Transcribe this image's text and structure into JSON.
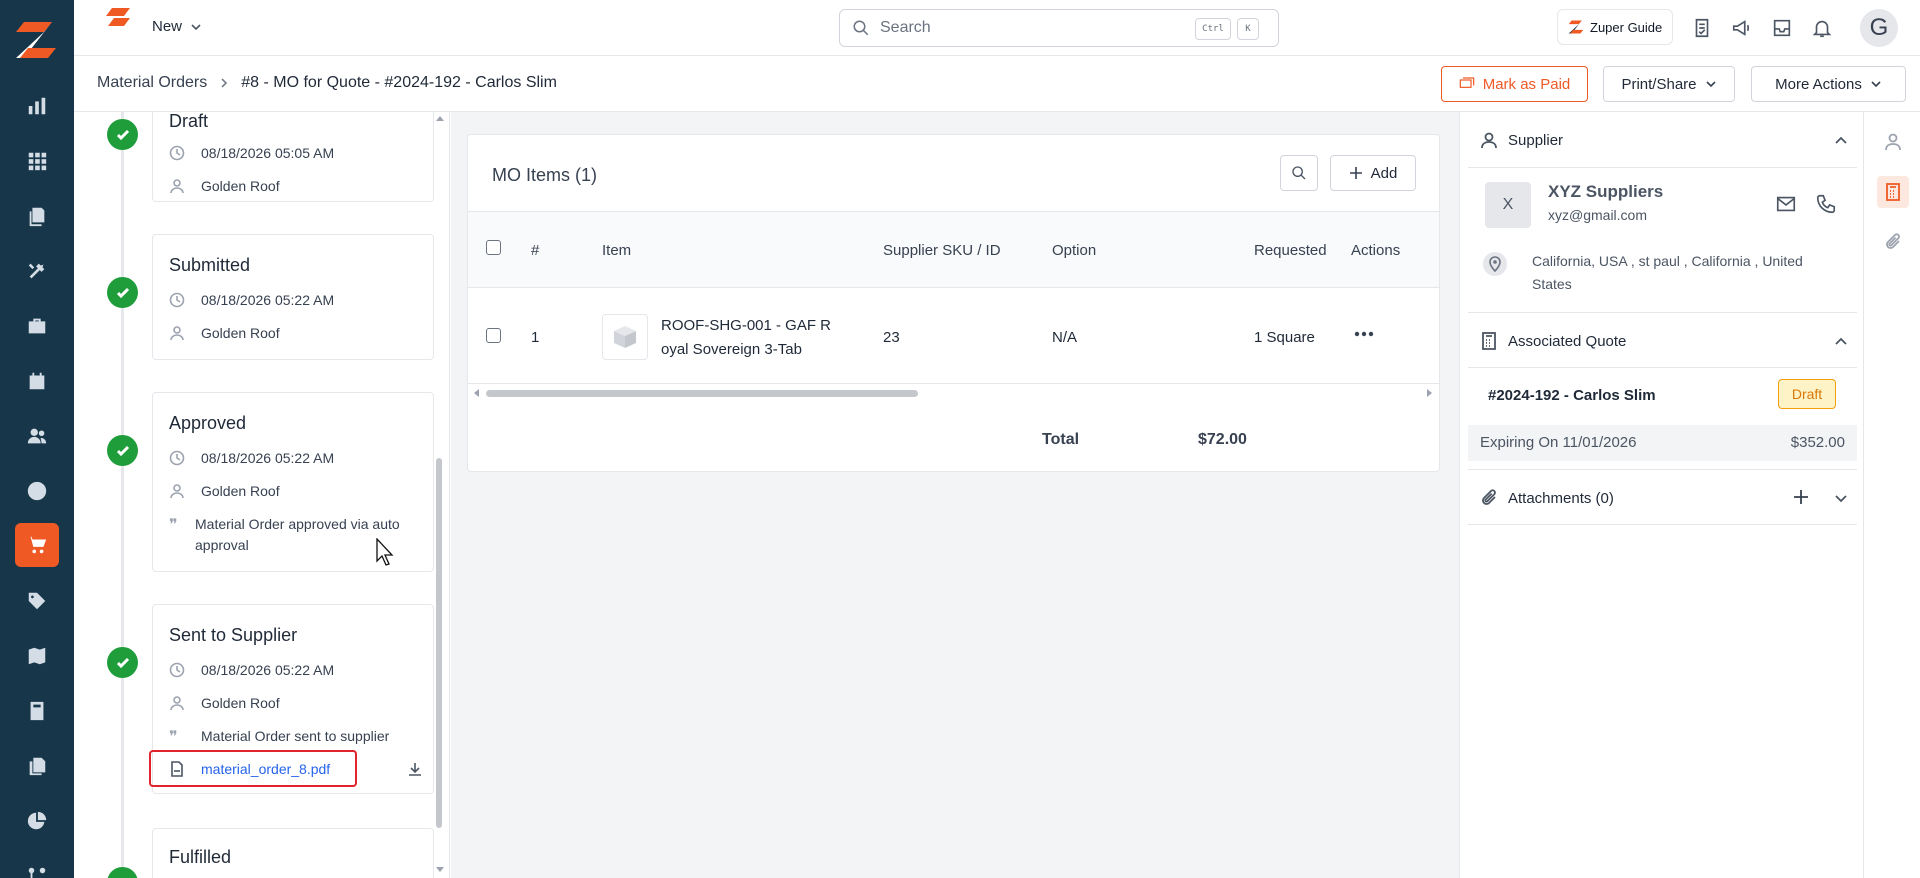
{
  "header": {
    "new_label": "New",
    "search_placeholder": "Search",
    "kbd_ctrl": "Ctrl",
    "kbd_k": "K",
    "guide_label": "Zuper Guide",
    "avatar_initial": "G"
  },
  "breadcrumb": {
    "root": "Material Orders",
    "current": "#8 - MO for Quote - #2024-192 - Carlos Slim"
  },
  "actions": {
    "mark_paid": "Mark as Paid",
    "print_share": "Print/Share",
    "more_actions": "More Actions"
  },
  "timeline": {
    "draft": {
      "title": "Draft",
      "date": "08/18/2026 05:05 AM",
      "user": "Golden Roof"
    },
    "submitted": {
      "title": "Submitted",
      "date": "08/18/2026 05:22 AM",
      "user": "Golden Roof"
    },
    "approved": {
      "title": "Approved",
      "date": "08/18/2026 05:22 AM",
      "user": "Golden Roof",
      "note": "Material Order approved via auto approval"
    },
    "sent": {
      "title": "Sent to Supplier",
      "date": "08/18/2026 05:22 AM",
      "user": "Golden Roof",
      "note": "Material Order sent to supplier",
      "file": "material_order_8.pdf"
    },
    "fulfilled": {
      "title": "Fulfilled"
    }
  },
  "mo_items": {
    "title": "MO Items (1)",
    "add_label": "Add",
    "columns": [
      "#",
      "Item",
      "Supplier SKU / ID",
      "Option",
      "Requested",
      "Actions"
    ],
    "rows": [
      {
        "num": "1",
        "item_line1": "ROOF-SHG-001 - GAF R",
        "item_line2": "oyal Sovereign 3-Tab",
        "sku": "23",
        "option": "N/A",
        "requested": "1 Square"
      }
    ],
    "total_label": "Total",
    "total_value": "$72.00"
  },
  "supplier": {
    "section_title": "Supplier",
    "avatar_initial": "X",
    "name": "XYZ Suppliers",
    "email": "xyz@gmail.com",
    "address_line1": "California, USA , st paul , California , United",
    "address_line2": "States"
  },
  "quote": {
    "section_title": "Associated Quote",
    "id": "#2024-192 - Carlos Slim",
    "status": "Draft",
    "expiring": "Expiring On 11/01/2026",
    "amount": "$352.00"
  },
  "attachments": {
    "section_title": "Attachments (0)"
  },
  "colors": {
    "sidebar": "#17364a",
    "accent": "#ef5a24",
    "success": "#1f9d3b",
    "link": "#2563eb",
    "highlight_box": "#e0242a"
  }
}
